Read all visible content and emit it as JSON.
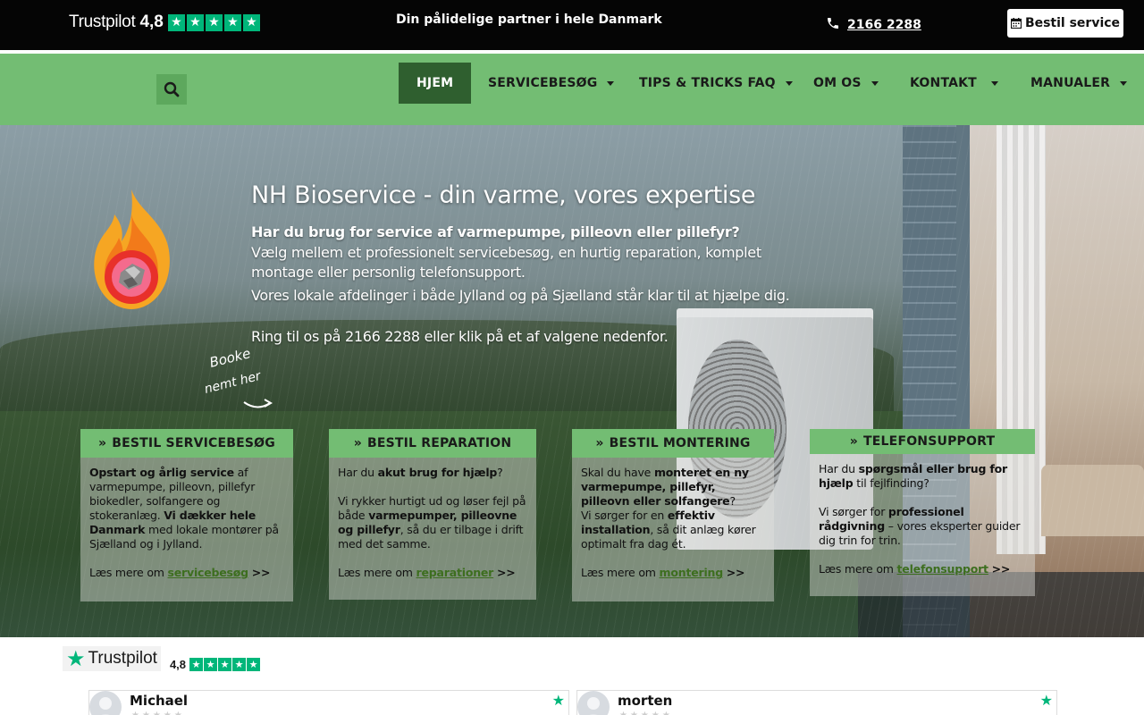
{
  "topbar": {
    "trustpilot_word": "Trustpilot",
    "trustpilot_score": "4,8",
    "tagline": "Din pålidelige partner i hele Danmark",
    "phone": "2166 2288",
    "cta_label": "Bestil service"
  },
  "nav": {
    "items": [
      {
        "label": "HJEM",
        "active": true
      },
      {
        "label": "SERVICEBESØG"
      },
      {
        "label": "TIPS & TRICKS FAQ"
      },
      {
        "label": "OM OS"
      },
      {
        "label": "KONTAKT"
      },
      {
        "label": "MANUALER"
      }
    ]
  },
  "hero": {
    "title": "NH Bioservice - din varme, vores expertise",
    "subtitle": "Har du brug for service af varmepumpe, pilleovn eller pillefyr?",
    "p1": "Vælg mellem et professionelt servicebesøg, en hurtig reparation, komplet montage eller personlig telefonsupport.",
    "p2": "Vores lokale afdelinger i både Jylland og på Sjælland står klar til at hjælpe dig.",
    "p3": "Ring til os på 2166 2288 eller klik på et af valgene nedenfor.",
    "handwritten_1": "Booke",
    "handwritten_2": "nemt her"
  },
  "cards": [
    {
      "title": "BESTIL SERVICEBESØG",
      "b1": "Opstart og årlig service",
      "t1": " af varmepumpe, pilleovn, pillefyr biokedler, solfangere og stokeranlæg. ",
      "b2": "Vi dækker hele Danmark",
      "t2": " med lokale montører på Sjælland og i Jylland.",
      "more_prefix": "Læs mere om ",
      "link": "servicebesøg",
      "arrow": ">>"
    },
    {
      "title": "BESTIL REPARATION",
      "t0": "Har du ",
      "b1": "akut brug for hjælp",
      "t1": "?",
      "t2": "Vi rykker hurtigt ud og løser fejl på både ",
      "b2": "varmepumper, pilleovne og pillefyr",
      "t3": ", så du er tilbage i drift med det samme.",
      "more_prefix": "Læs mere om ",
      "link": "reparationer",
      "arrow": ">>"
    },
    {
      "title": "BESTIL MONTERING",
      "t0": "Skal du have ",
      "b1": "monteret en ny varmepumpe, pillefyr, pilleovn eller solfangere",
      "t1": "?",
      "t2": "Vi sørger for en ",
      "b2": "effektiv installation",
      "t3": ", så dit anlæg kører optimalt fra dag ét.",
      "more_prefix": "Læs mere om ",
      "link": "montering",
      "arrow": ">>"
    },
    {
      "title": "TELEFONSUPPORT",
      "t0": "Har du ",
      "b1": "spørgsmål eller brug for hjælp",
      "t1": " til fejlfinding?",
      "t2": "Vi sørger for ",
      "b2": "professionel rådgivning",
      "t3": " – vores eksperter guider dig trin for trin.",
      "more_prefix": "Læs mere om ",
      "link": "telefonsupport",
      "arrow": ">>"
    }
  ],
  "reviews": {
    "trustpilot_word": "Trustpilot",
    "score": "4,8",
    "items": [
      {
        "name": "Michael"
      },
      {
        "name": "morten"
      }
    ]
  },
  "colors": {
    "nav_green": "#73bd73",
    "active_green": "#2f5f2f",
    "trustpilot_green": "#00b67a",
    "link_green": "#3d6e1f"
  }
}
